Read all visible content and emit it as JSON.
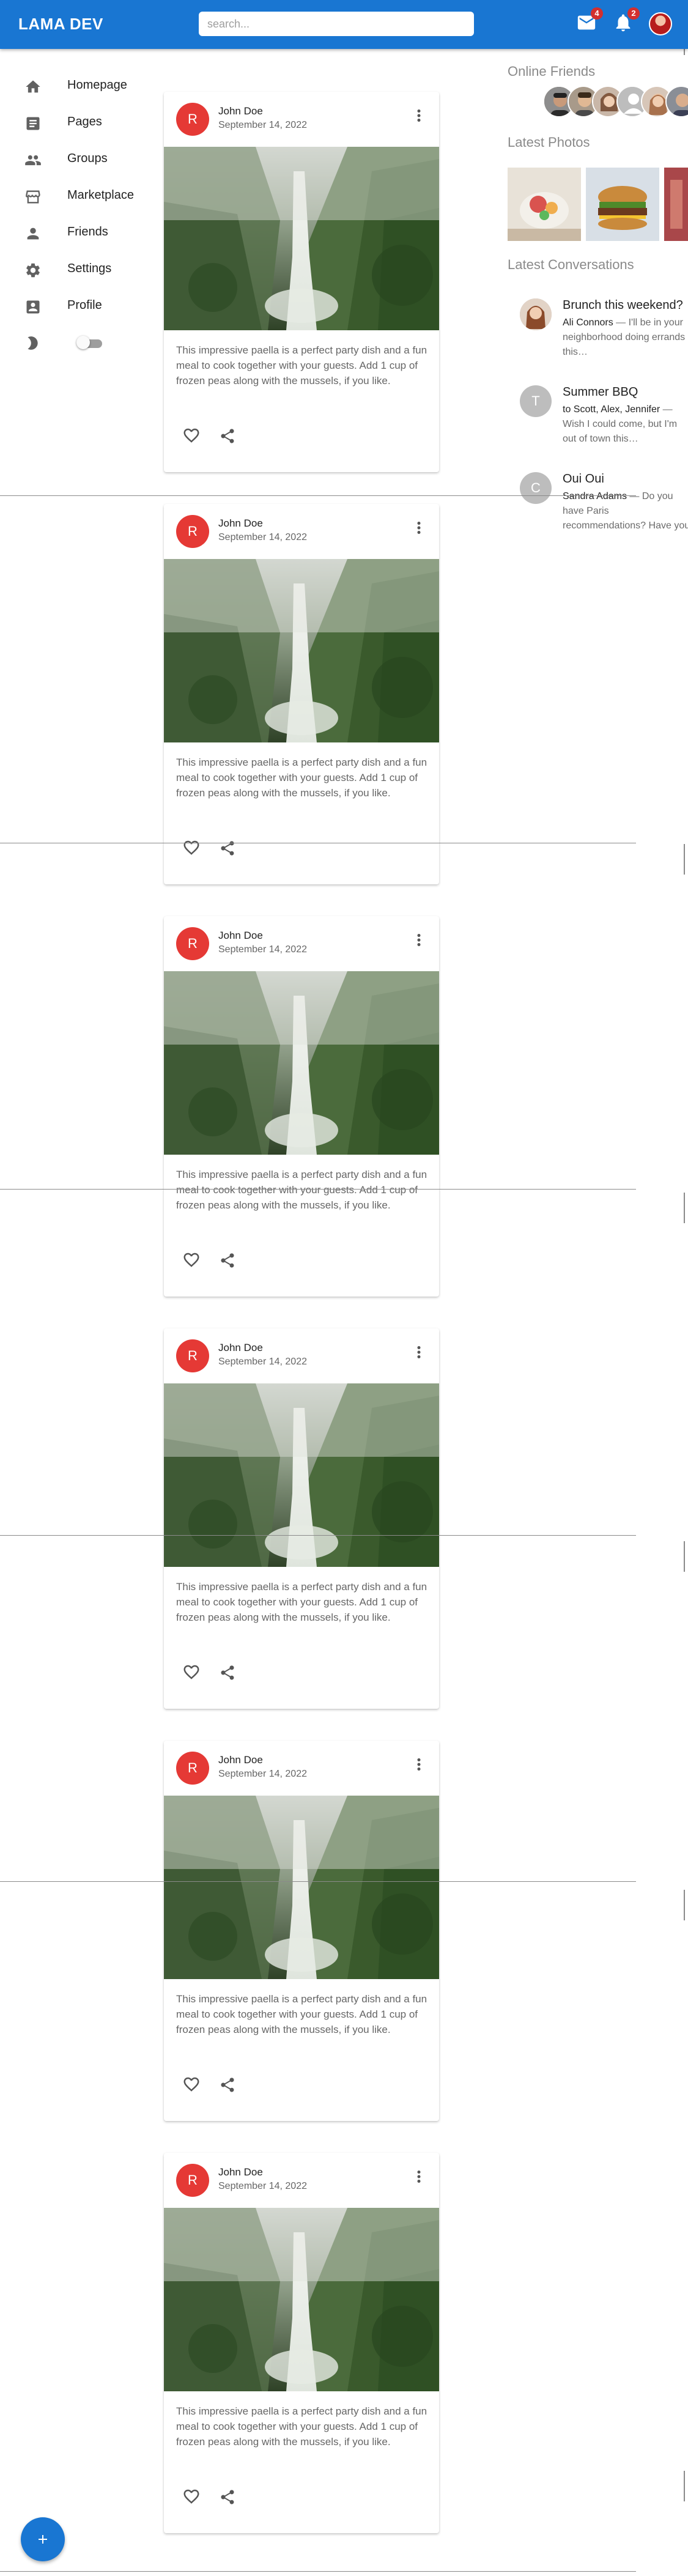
{
  "app": {
    "title": "LAMA DEV"
  },
  "search": {
    "placeholder": "search..."
  },
  "header": {
    "mail_badge": "4",
    "notif_badge": "2",
    "avatar": "user-avatar"
  },
  "sidebar": {
    "items": [
      {
        "label": "Homepage",
        "icon": "home-icon"
      },
      {
        "label": "Pages",
        "icon": "article-icon"
      },
      {
        "label": "Groups",
        "icon": "group-icon"
      },
      {
        "label": "Marketplace",
        "icon": "storefront-icon"
      },
      {
        "label": "Friends",
        "icon": "person-icon"
      },
      {
        "label": "Settings",
        "icon": "gear-icon"
      },
      {
        "label": "Profile",
        "icon": "account-box-icon"
      }
    ],
    "dark_mode": {
      "icon": "moon-icon",
      "enabled": false
    }
  },
  "posts": [
    {
      "avatar_letter": "R",
      "author": "John Doe",
      "date": "September 14, 2022",
      "text": "This impressive paella is a perfect party dish and a fun meal to cook together with your guests. Add 1 cup of frozen peas along with the mussels, if you like."
    },
    {
      "avatar_letter": "R",
      "author": "John Doe",
      "date": "September 14, 2022",
      "text": "This impressive paella is a perfect party dish and a fun meal to cook together with your guests. Add 1 cup of frozen peas along with the mussels, if you like."
    },
    {
      "avatar_letter": "R",
      "author": "John Doe",
      "date": "September 14, 2022",
      "text": "This impressive paella is a perfect party dish and a fun meal to cook together with your guests. Add 1 cup of frozen peas along with the mussels, if you like."
    },
    {
      "avatar_letter": "R",
      "author": "John Doe",
      "date": "September 14, 2022",
      "text": "This impressive paella is a perfect party dish and a fun meal to cook together with your guests. Add 1 cup of frozen peas along with the mussels, if you like."
    },
    {
      "avatar_letter": "R",
      "author": "John Doe",
      "date": "September 14, 2022",
      "text": "This impressive paella is a perfect party dish and a fun meal to cook together with your guests. Add 1 cup of frozen peas along with the mussels, if you like."
    },
    {
      "avatar_letter": "R",
      "author": "John Doe",
      "date": "September 14, 2022",
      "text": "This impressive paella is a perfect party dish and a fun meal to cook together with your guests. Add 1 cup of frozen peas along with the mussels, if you like."
    }
  ],
  "rightbar": {
    "online_title": "Online Friends",
    "photos_title": "Latest Photos",
    "conversations_title": "Latest Conversations",
    "conversations": [
      {
        "title": "Brunch this weekend?",
        "author": "Ali Connors",
        "preview": " — I'll be in your neighborhood doing errands this…",
        "avatar_letter": ""
      },
      {
        "title": "Summer BBQ",
        "author": "to Scott, Alex, Jennifer",
        "preview": " — Wish I could come, but I'm out of town this…",
        "avatar_letter": "T"
      },
      {
        "title": "Oui Oui",
        "author": "Sandra Adams",
        "preview": " — Do you have Paris recommendations? Have you ever…",
        "avatar_letter": "C"
      }
    ]
  },
  "colors": {
    "primary": "#1976d2",
    "badge": "#d32f2f",
    "avatar": "#e53935"
  }
}
